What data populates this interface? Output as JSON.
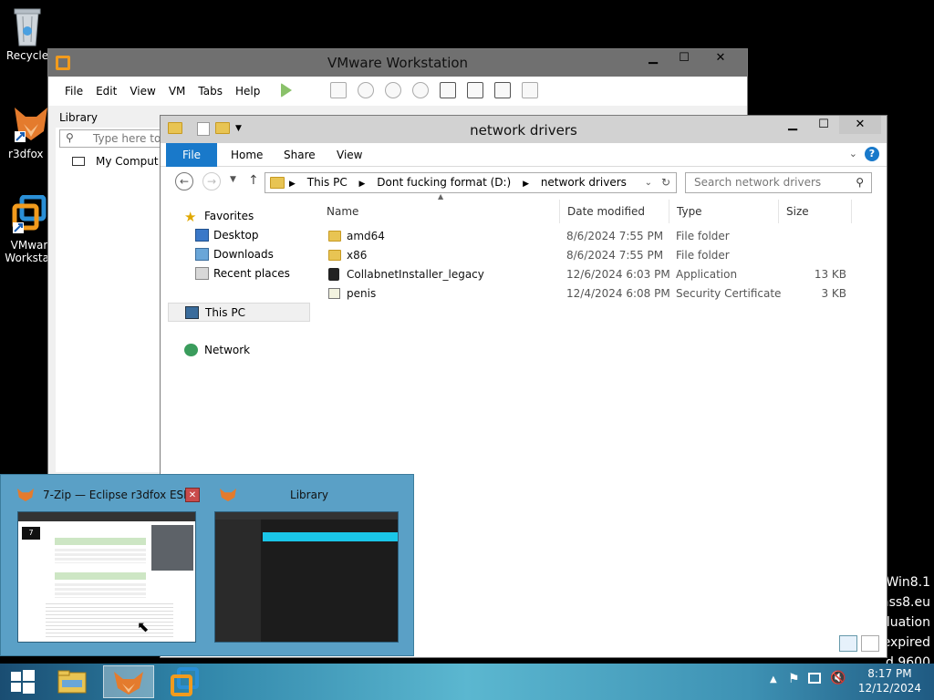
{
  "desktop": {
    "icons": [
      {
        "label": "Recycle"
      },
      {
        "label": "r3dfox E"
      },
      {
        "label": "VMwar Workstat"
      }
    ],
    "watermark": [
      "Win8.1",
      "ass8.eu",
      "luation",
      "expired",
      "d 9600"
    ]
  },
  "vmware": {
    "title": "VMware Workstation",
    "menu": [
      "File",
      "Edit",
      "View",
      "VM",
      "Tabs",
      "Help"
    ],
    "library_title": "Library",
    "search_placeholder": "Type here to s",
    "tree_item": "My Comput"
  },
  "explorer": {
    "title": "network drivers",
    "ribbon_tabs": [
      "File",
      "Home",
      "Share",
      "View"
    ],
    "breadcrumb": [
      "This PC",
      "Dont fucking format (D:)",
      "network drivers"
    ],
    "search_placeholder": "Search network drivers",
    "nav": {
      "favorites": "Favorites",
      "desktop": "Desktop",
      "downloads": "Downloads",
      "recent": "Recent places",
      "this_pc": "This PC",
      "network": "Network"
    },
    "columns": {
      "name": "Name",
      "date": "Date modified",
      "type": "Type",
      "size": "Size"
    },
    "files": [
      {
        "name": "amd64",
        "date": "8/6/2024 7:55 PM",
        "type": "File folder",
        "size": "",
        "icon": "folder-icon"
      },
      {
        "name": "x86",
        "date": "8/6/2024 7:55 PM",
        "type": "File folder",
        "size": "",
        "icon": "folder-icon"
      },
      {
        "name": "CollabnetInstaller_legacy",
        "date": "12/6/2024 6:03 PM",
        "type": "Application",
        "size": "13 KB",
        "icon": "application-icon"
      },
      {
        "name": "penis",
        "date": "12/4/2024 6:08 PM",
        "type": "Security Certificate",
        "size": "3 KB",
        "icon": "certificate-icon"
      }
    ]
  },
  "thumbnails": [
    {
      "title": "7-Zip — Eclipse r3dfox ESR"
    },
    {
      "title": "Library"
    }
  ],
  "clock": {
    "time": "8:17 PM",
    "date": "12/12/2024"
  },
  "colors": {
    "accent": "#1979ca",
    "taskbar": "#2f84a8"
  }
}
